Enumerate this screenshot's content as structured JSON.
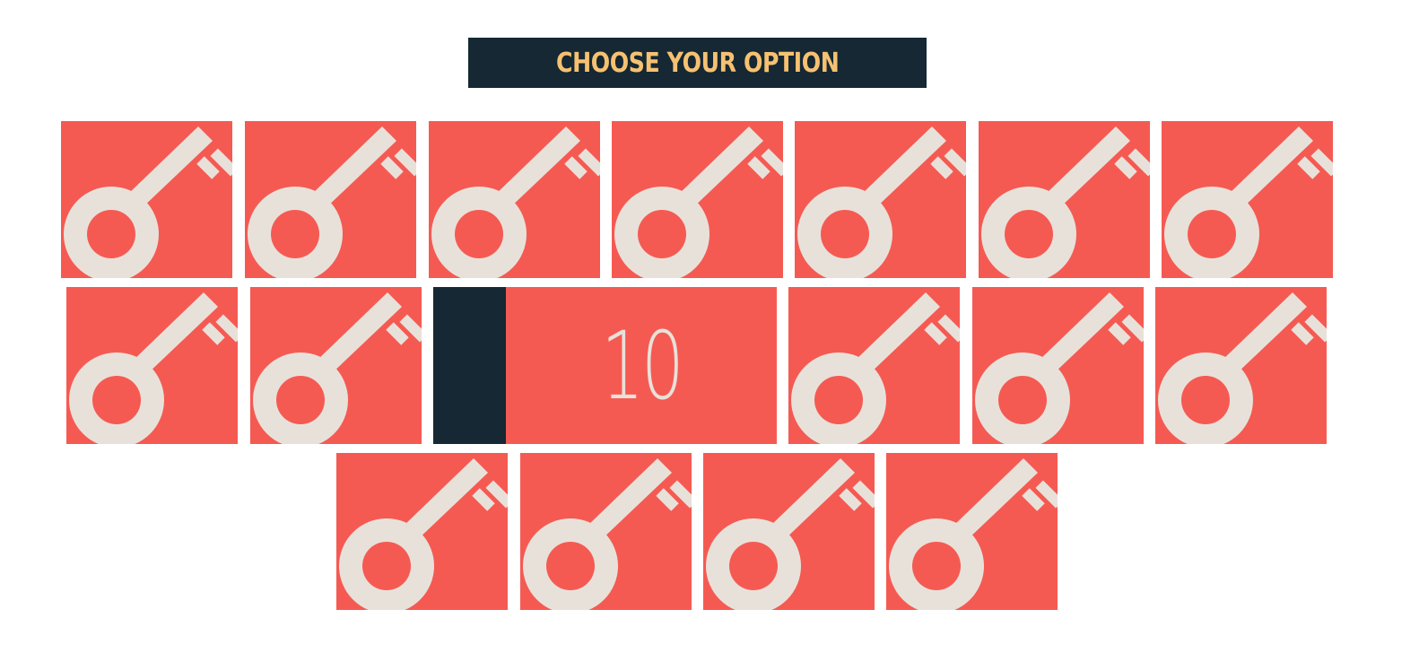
{
  "header": {
    "title": "CHOOSE YOUR OPTION"
  },
  "colors": {
    "tile": "#f55a52",
    "key": "#e8e1da",
    "dark": "#152833",
    "title_text": "#f6c171",
    "background": "#ffffff"
  },
  "tiles": {
    "icon": "key-icon",
    "row_counts": [
      7,
      6,
      4
    ],
    "revealed": {
      "value": "10"
    }
  }
}
